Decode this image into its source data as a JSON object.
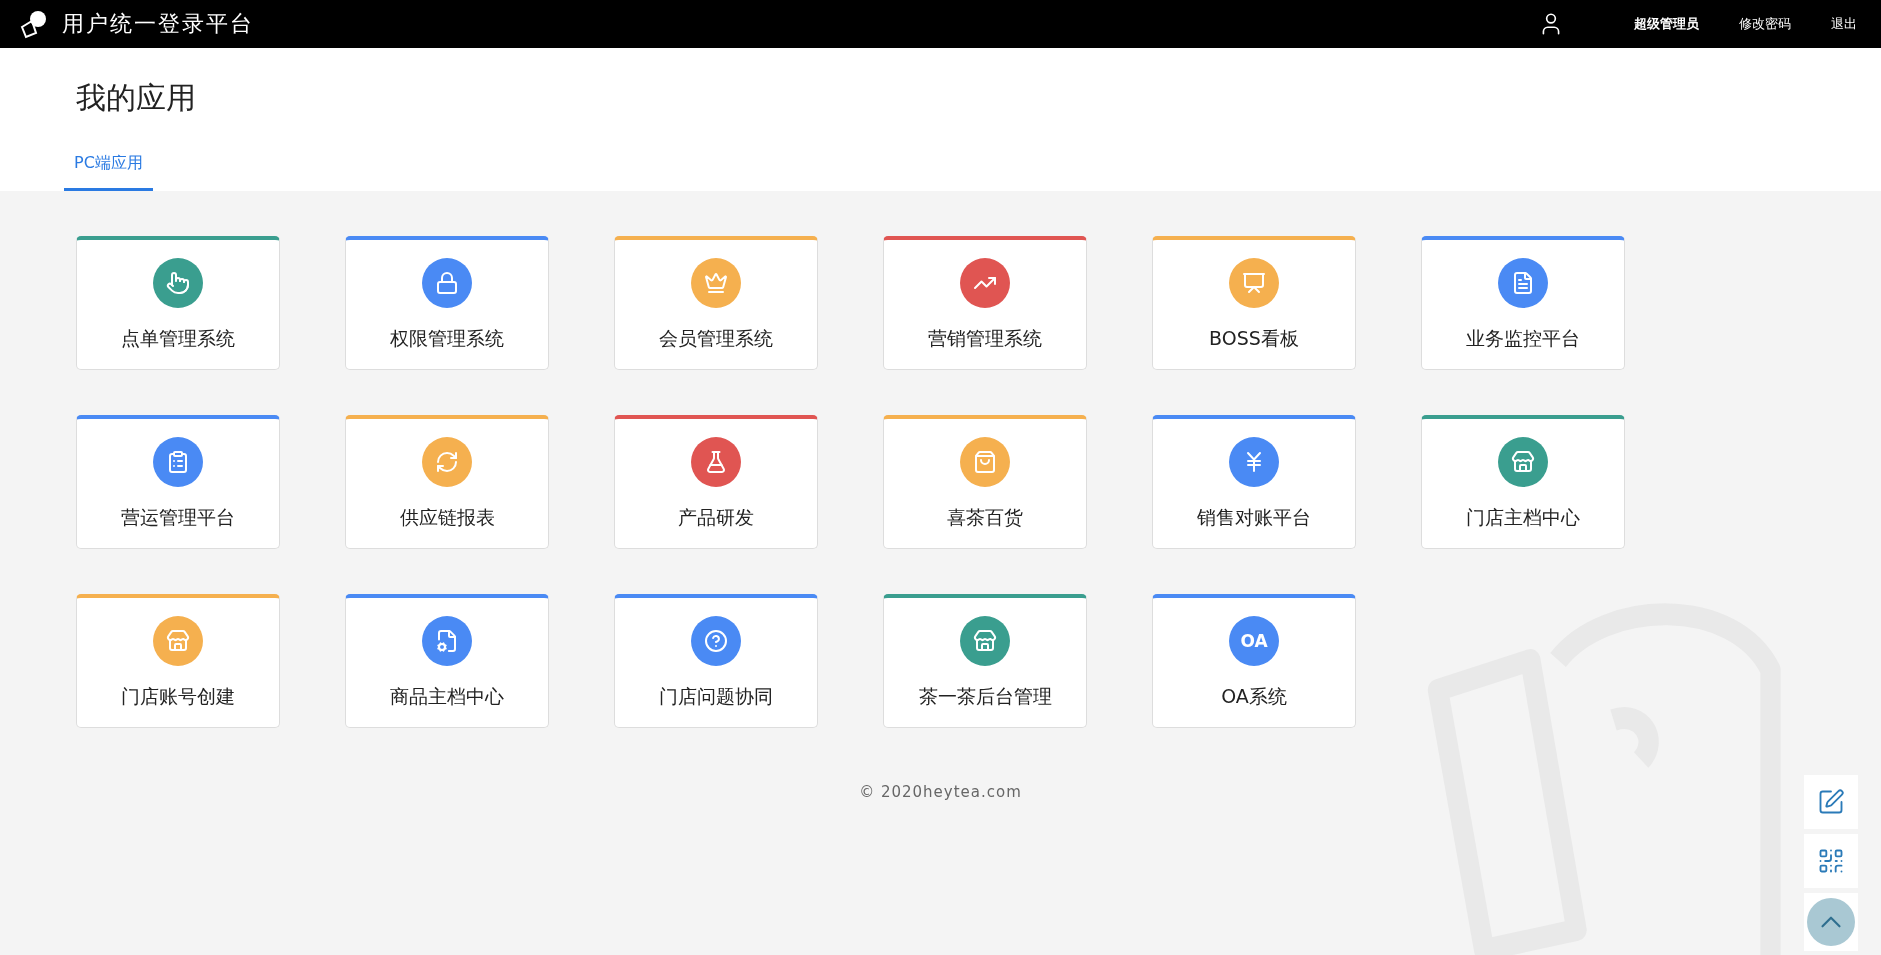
{
  "header": {
    "title": "用户统一登录平台",
    "links": [
      "超级管理员",
      "修改密码",
      "退出"
    ]
  },
  "page_title": "我的应用",
  "tabs": [
    {
      "label": "PC端应用",
      "selected": true
    }
  ],
  "apps": [
    {
      "name": "点单管理系统",
      "color": "#3a9e8f",
      "kind": "icon"
    },
    {
      "name": "权限管理系统",
      "color": "#4a8af4",
      "kind": "icon"
    },
    {
      "name": "会员管理系统",
      "color": "#f5b04f",
      "kind": "icon"
    },
    {
      "name": "营销管理系统",
      "color": "#e05552",
      "kind": "icon"
    },
    {
      "name": "BOSS看板",
      "color": "#f5b04f",
      "kind": "icon"
    },
    {
      "name": "业务监控平台",
      "color": "#4a8af4",
      "kind": "icon"
    },
    {
      "name": "营运管理平台",
      "color": "#4a8af4",
      "kind": "icon"
    },
    {
      "name": "供应链报表",
      "color": "#f5b04f",
      "kind": "icon"
    },
    {
      "name": "产品研发",
      "color": "#e05552",
      "kind": "icon"
    },
    {
      "name": "喜茶百货",
      "color": "#f5b04f",
      "kind": "icon"
    },
    {
      "name": "销售对账平台",
      "color": "#4a8af4",
      "kind": "icon"
    },
    {
      "name": "门店主档中心",
      "color": "#3a9e8f",
      "kind": "icon"
    },
    {
      "name": "门店账号创建",
      "color": "#f5b04f",
      "kind": "icon"
    },
    {
      "name": "商品主档中心",
      "color": "#4a8af4",
      "kind": "icon"
    },
    {
      "name": "门店问题协同",
      "color": "#4a8af4",
      "kind": "icon"
    },
    {
      "name": "茶一茶后台管理",
      "color": "#3a9e8f",
      "kind": "icon"
    },
    {
      "name": "OA系统",
      "color": "#4a8af4",
      "kind": "text",
      "icon_text": "OA"
    }
  ],
  "footer": "© 2020heytea.com"
}
